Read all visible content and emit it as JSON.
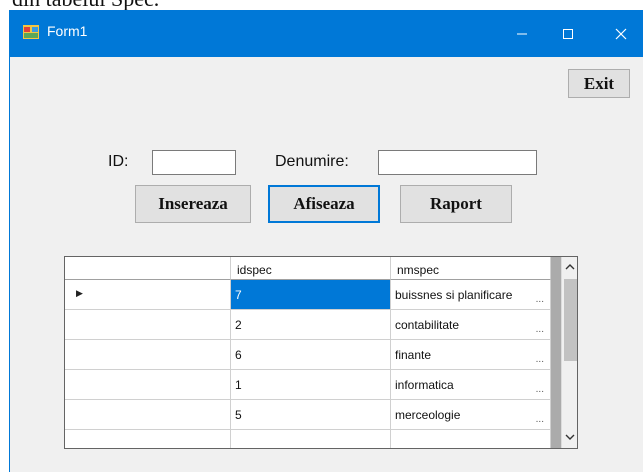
{
  "doc_caption": "din tabelul Spec.",
  "window": {
    "title": "Form1",
    "minimize": "—",
    "maximize": "☐",
    "close": "✕"
  },
  "buttons": {
    "exit": "Exit",
    "insert": "Insereaza",
    "show": "Afiseaza",
    "report": "Raport"
  },
  "form": {
    "id_label": "ID:",
    "id_value": "",
    "name_label": "Denumire:",
    "name_value": ""
  },
  "grid": {
    "columns": [
      "idspec",
      "nmspec"
    ],
    "rows": [
      {
        "idspec": "7",
        "nmspec": "buissnes si planificare",
        "ellipsis": "..."
      },
      {
        "idspec": "2",
        "nmspec": "contabilitate",
        "ellipsis": "..."
      },
      {
        "idspec": "6",
        "nmspec": "finante",
        "ellipsis": "..."
      },
      {
        "idspec": "1",
        "nmspec": "informatica",
        "ellipsis": "..."
      },
      {
        "idspec": "5",
        "nmspec": "merceologie",
        "ellipsis": "..."
      }
    ],
    "current_row_marker": "▶"
  },
  "colors": {
    "titlebar": "#0078d7",
    "selection": "#0078d7",
    "window_bg": "#f0f0f0"
  }
}
